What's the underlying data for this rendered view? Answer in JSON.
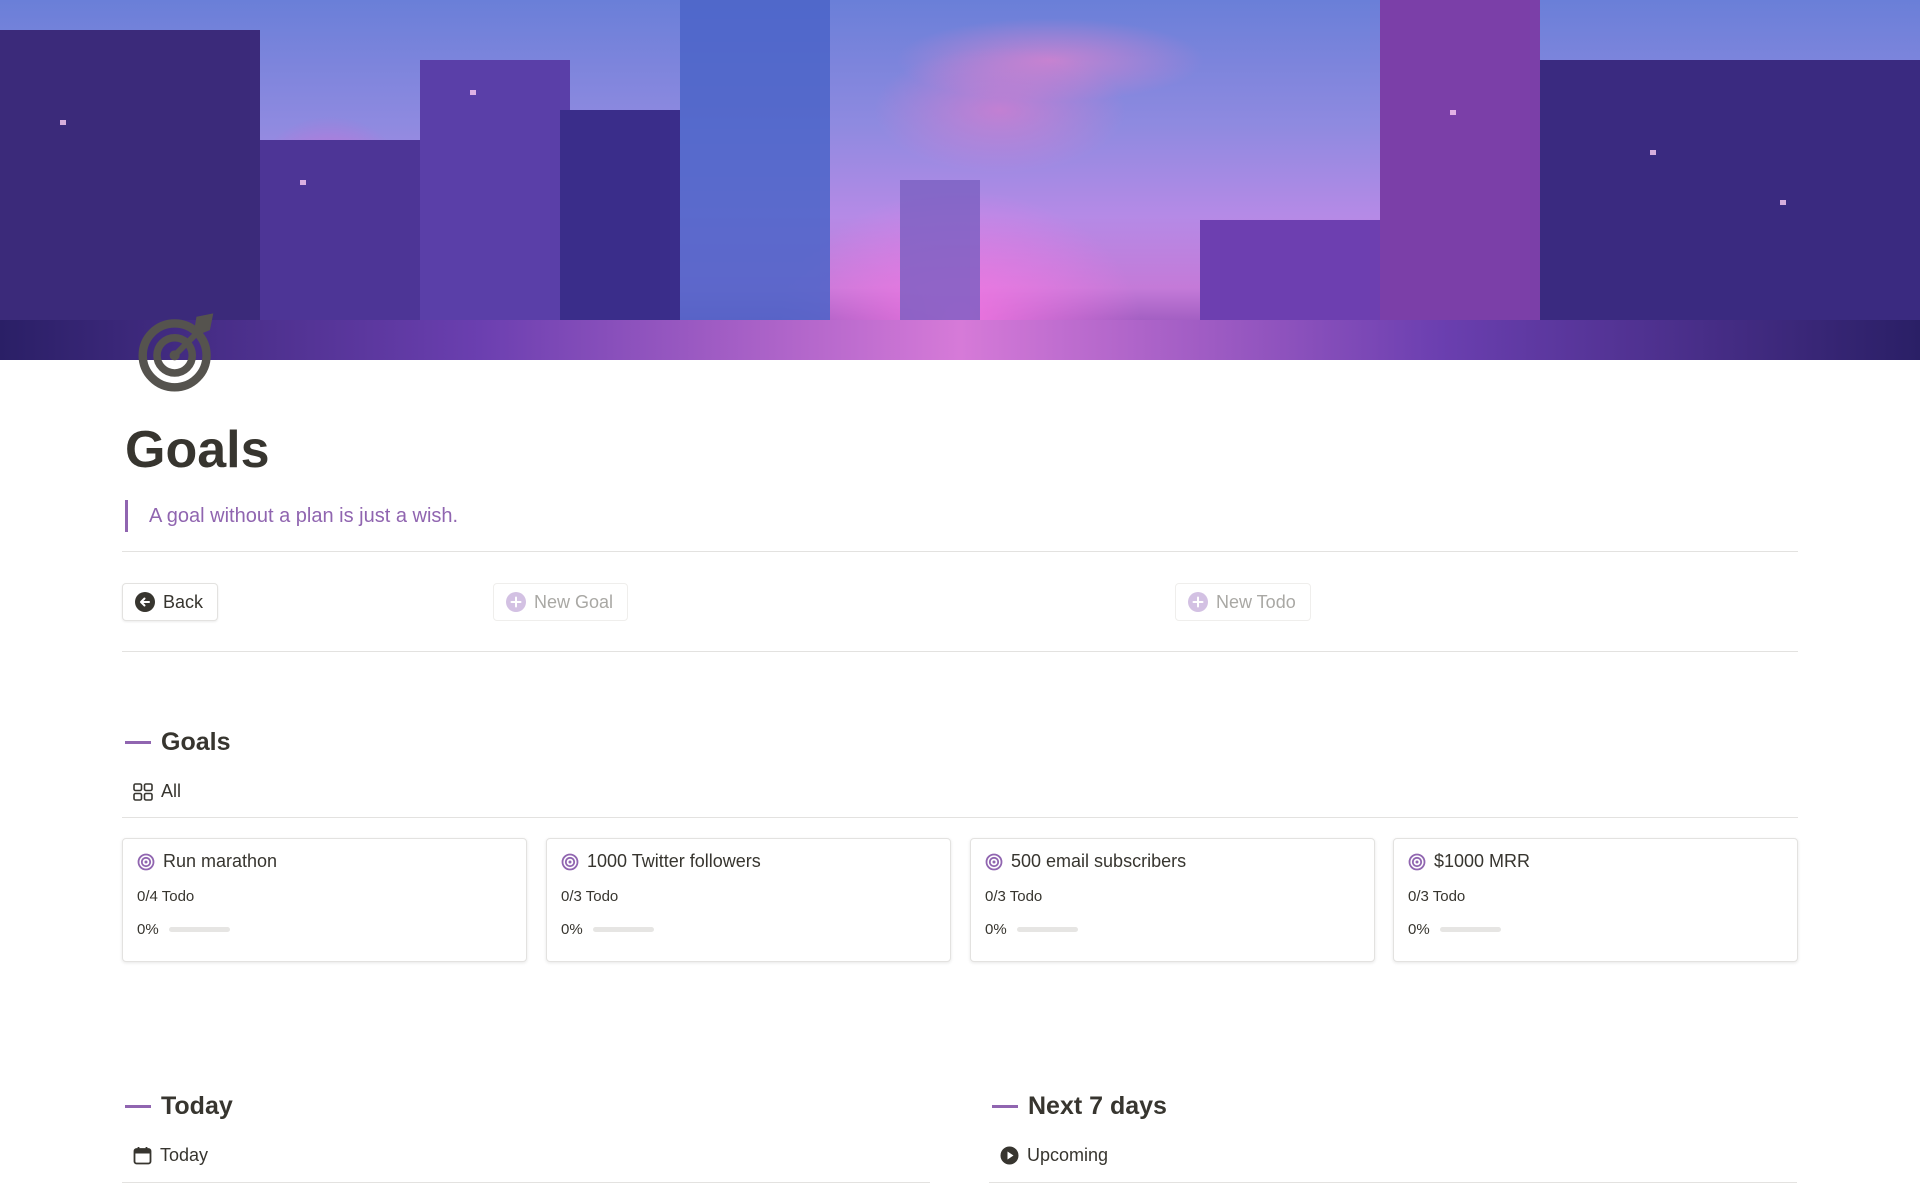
{
  "page": {
    "icon": "target-icon",
    "title": "Goals",
    "quote": "A goal without a plan is just a wish."
  },
  "buttons": {
    "back": "Back",
    "new_goal": "New Goal",
    "new_todo": "New Todo"
  },
  "colors": {
    "accent": "#9065b0",
    "text": "#37352f",
    "muted": "#a9a8a4",
    "border": "#e3e2e0"
  },
  "goals_section": {
    "heading": "Goals",
    "view_label": "All",
    "view_icon": "gallery-grid-icon",
    "cards": [
      {
        "title": "Run marathon",
        "todo": "0/4 Todo",
        "progress_label": "0%",
        "progress": 0
      },
      {
        "title": "1000 Twitter followers",
        "todo": "0/3 Todo",
        "progress_label": "0%",
        "progress": 0
      },
      {
        "title": "500 email subscribers",
        "todo": "0/3 Todo",
        "progress_label": "0%",
        "progress": 0
      },
      {
        "title": "$1000 MRR",
        "todo": "0/3 Todo",
        "progress_label": "0%",
        "progress": 0
      }
    ]
  },
  "today_section": {
    "heading": "Today",
    "view_label": "Today",
    "view_icon": "calendar-icon"
  },
  "next7_section": {
    "heading": "Next 7 days",
    "view_label": "Upcoming",
    "view_icon": "play-circle-icon"
  }
}
